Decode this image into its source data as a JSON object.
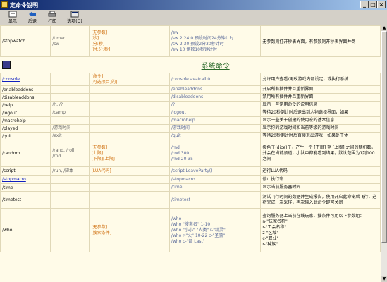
{
  "window": {
    "title": "定命令說明"
  },
  "toolbar": {
    "buttons": [
      {
        "label": "显示",
        "icon": "display-icon"
      },
      {
        "label": "后退",
        "icon": "back-icon"
      },
      {
        "label": "打印",
        "icon": "print-icon"
      },
      {
        "label": "选项(O)",
        "icon": "options-icon"
      }
    ]
  },
  "top_row": {
    "cmd": "/stopwatch",
    "aliases": [
      "/timer",
      "/sw"
    ],
    "params": [
      "[无参数]",
      "[秒]",
      "[分:秒]",
      "[时:分:秒]"
    ],
    "examples": [
      "/sw",
      "/sw 2:24:0 预设时间24分钟计时",
      "/sw 2:30 预设2分30秒计时",
      "/sw 10 倒数10秒钟计时"
    ],
    "desc": "无参数则打开秒表界面，有参数则开秒表界面并倒"
  },
  "section": {
    "title": "系统命令"
  },
  "rows": [
    {
      "cmd": "/console",
      "link": true,
      "aliases": [],
      "params": [
        "[命令]",
        "[可选项目]的]"
      ],
      "examples": [
        "/console avatrall 0"
      ],
      "desc": "允许用户查看/更改游戏内部设定，或执行系统"
    },
    {
      "cmd": "/enableaddons",
      "link": false,
      "aliases": [],
      "params": [],
      "examples": [
        "/enableaddons"
      ],
      "desc": "开启所有插件并且重新界面"
    },
    {
      "cmd": "/disableaddons",
      "link": false,
      "aliases": [],
      "params": [],
      "examples": [
        "/disableaddons"
      ],
      "desc": "禁用所有插件并且重新界面"
    },
    {
      "cmd": "/help",
      "link": false,
      "aliases": [
        "/h, /?"
      ],
      "params": [],
      "examples": [
        "/?"
      ],
      "desc": "显示一些常用命令的说明信息"
    },
    {
      "cmd": "/logout",
      "link": false,
      "aliases": [
        "/camp"
      ],
      "params": [],
      "examples": [
        "/logout"
      ],
      "desc": "等待20秒倒计时后退出到人物选择界面，如果"
    },
    {
      "cmd": "/macrohelp",
      "link": false,
      "aliases": [],
      "params": [],
      "examples": [
        "/macrohelp"
      ],
      "desc": "显示一些关于创建的使用宏的基本信息"
    },
    {
      "cmd": "/played",
      "link": false,
      "aliases": [
        "/游戏时间"
      ],
      "params": [],
      "examples": [
        "/游戏时间"
      ],
      "desc": "显示你的游戏时间和当前等级的游戏时间"
    },
    {
      "cmd": "/quit",
      "link": false,
      "aliases": [
        "/exit"
      ],
      "params": [],
      "examples": [
        "/quit"
      ],
      "desc": "等待20秒倒计时后直接退出游戏，如果处于休"
    },
    {
      "cmd": "/random",
      "link": false,
      "aliases": [
        "/rand, /roll",
        "/rnd"
      ],
      "params": [
        "[无参数]",
        "[上限]",
        "[下限][上限]"
      ],
      "examples": [
        "/rnd",
        "/rnd 300",
        "/rnd 20 35"
      ],
      "desc": "掷色子(dice)子，产生一个 [下限] 至 [上限] 之间的随机数，并会在当前频道，小队中都能看到结果。默认范围为1到100之间"
    },
    {
      "cmd": "/script",
      "link": false,
      "aliases": [
        "/run, /脚本"
      ],
      "params": [
        "[LUA代码]"
      ],
      "examples": [
        "/script LeaveParty()"
      ],
      "desc": "运行LUA代码"
    },
    {
      "cmd": "/stopmacro",
      "link": true,
      "aliases": [],
      "params": [],
      "examples": [
        "/stopmacro"
      ],
      "desc": "停止执行宏"
    },
    {
      "cmd": "/time",
      "link": false,
      "aliases": [],
      "params": [],
      "examples": [
        "/time"
      ],
      "desc": "显示当前服务器时间"
    },
    {
      "cmd": "/timetest",
      "link": false,
      "aliases": [],
      "params": [],
      "examples": [
        "/timetest"
      ],
      "desc": "测试飞行时间的数据并生成报告，使用开启此命令后飞行，这将完成一次采样，再次输入此命令即可关闭"
    },
    {
      "cmd": "/who",
      "link": false,
      "aliases": [],
      "params": [
        "[无参数]",
        "[搜索条件]"
      ],
      "examples": [
        "/who",
        "/who \"搜索名\" 1-10",
        "/who \"小小\" \"人类\" r-\"精灵\"",
        "/who r-\"火\" 10-22 c-\"圣骑\"",
        "/who c-\"部 Last\""
      ],
      "desc": "查询服务器上当前在线玩家，搜条件可用以下参数组：\nn-\"玩家名称\"\nr-\"工会名称\"\nz-\"区域\"\nc-\"职业\"\nr-\"种族\""
    }
  ]
}
